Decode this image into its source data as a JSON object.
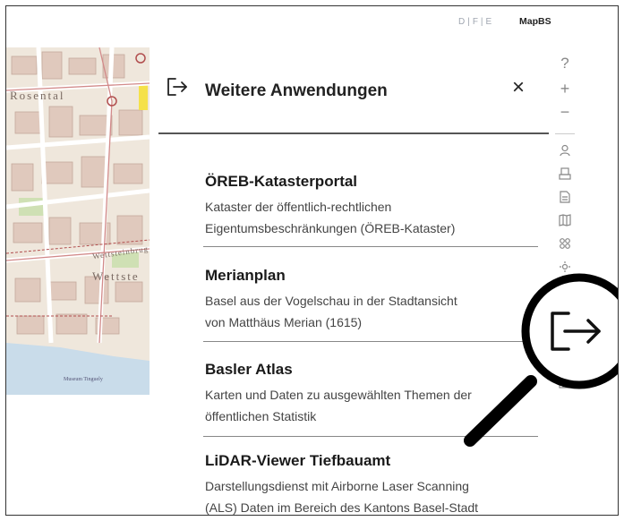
{
  "header": {
    "lang_switch": "D|F|E",
    "brand": "MapBS"
  },
  "map": {
    "labels": [
      "Rosental",
      "Wettsteinbrug",
      "Wettste",
      "Museum Tinguely"
    ]
  },
  "panel": {
    "title": "Weitere Anwendungen",
    "close": "×",
    "apps": [
      {
        "name": "ÖREB-Katasterportal",
        "desc1": "Kataster der öffentlich-rechtlichen",
        "desc2": "Eigentumsbeschränkungen (ÖREB-Kataster)"
      },
      {
        "name": "Merianplan",
        "desc1": "Basel aus der Vogelschau in der Stadtansicht",
        "desc2": "von Matthäus Merian (1615)"
      },
      {
        "name": "Basler Atlas",
        "desc1": "Karten und Daten zu ausgewählten Themen der",
        "desc2": "öffentlichen Statistik"
      },
      {
        "name": "LiDAR-Viewer Tiefbauamt",
        "desc1": "Darstellungsdienst mit Airborne Laser Scanning",
        "desc2": "(ALS) Daten im Bereich des Kantons Basel-Stadt"
      }
    ]
  },
  "toolbar": {
    "help": "?",
    "zoom_in": "+",
    "zoom_out": "−"
  },
  "icons": {
    "panel_exit": "exit-arrow-icon",
    "magnified": "exit-arrow-icon"
  }
}
